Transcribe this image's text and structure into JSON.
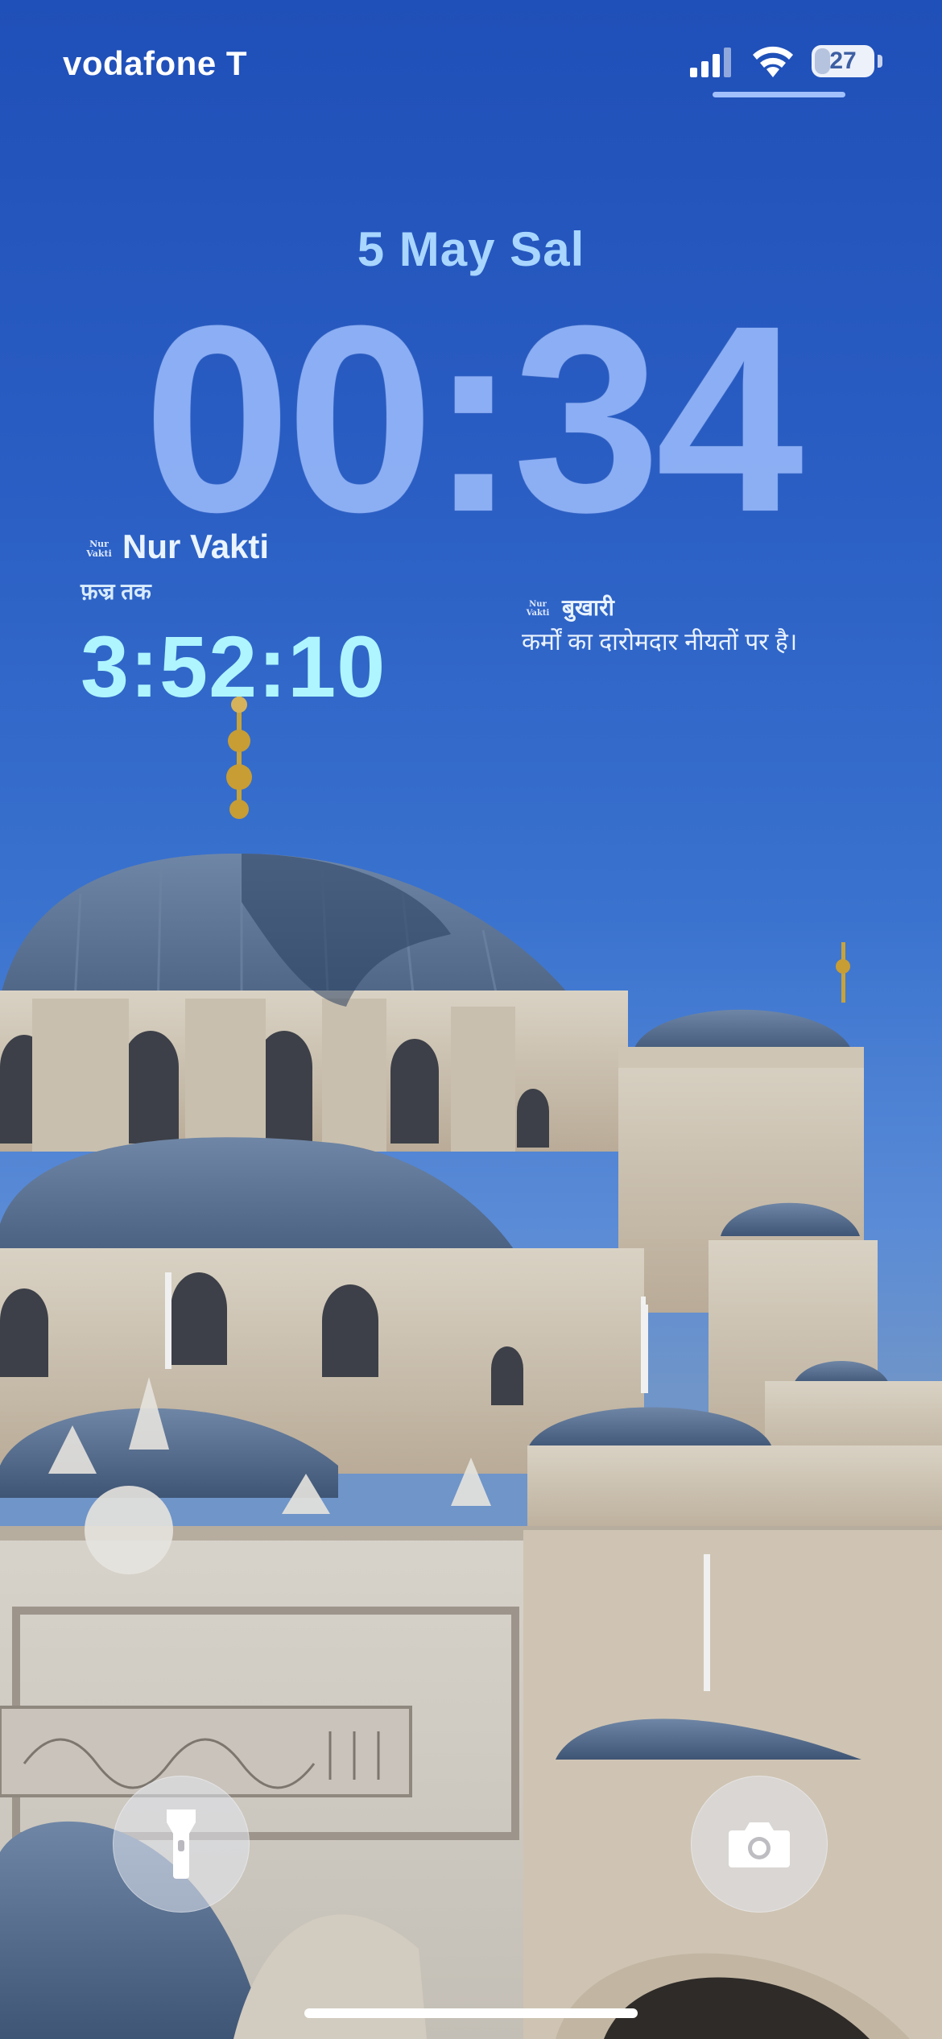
{
  "status_bar": {
    "carrier": "vodafone T",
    "battery_level": "27",
    "icons": [
      "cellular-signal-icon",
      "wifi-icon",
      "battery-icon"
    ]
  },
  "lockscreen": {
    "date": "5 May Sal",
    "time": "00:34"
  },
  "widget_prayer": {
    "logo_text": "Nur Vakti",
    "app_name": "Nur Vakti",
    "subtitle": "फ़ज्र तक",
    "countdown": "3:52:10"
  },
  "widget_hadith": {
    "logo_text": "Nur Vakti",
    "source": "बुखारी",
    "quote": "कर्मों का दारोमदार नीयतों पर है।"
  },
  "quick_actions": {
    "left": "flashlight-icon",
    "right": "camera-icon"
  },
  "colors": {
    "sky_top": "#1f4fb8",
    "date_text": "#a8d6ff",
    "clock": "#96b9ff",
    "countdown": "#aef5ff"
  }
}
